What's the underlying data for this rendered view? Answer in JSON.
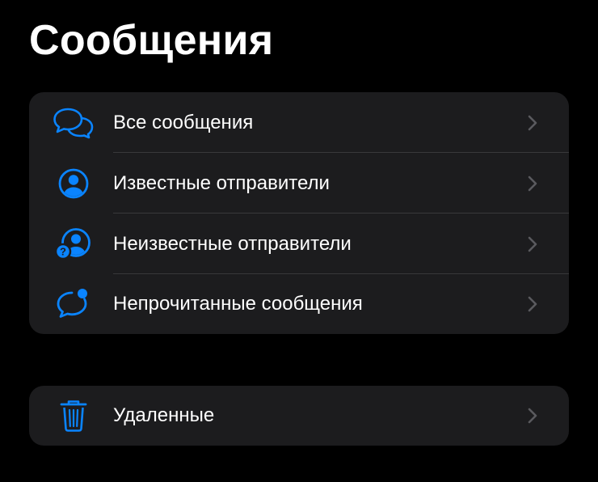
{
  "header": {
    "title": "Сообщения"
  },
  "filters": [
    {
      "id": "all",
      "label": "Все сообщения",
      "icon": "chat-bubbles-icon"
    },
    {
      "id": "known",
      "label": "Известные отправители",
      "icon": "person-circle-icon"
    },
    {
      "id": "unknown",
      "label": "Неизвестные отправители",
      "icon": "person-question-icon"
    },
    {
      "id": "unread",
      "label": "Непрочитанные сообщения",
      "icon": "unread-bubble-icon"
    }
  ],
  "trash": {
    "label": "Удаленные",
    "icon": "trash-icon"
  },
  "colors": {
    "accent": "#0a84ff",
    "background": "#000000",
    "group": "#1c1c1e",
    "separator": "#38383a",
    "chevron": "#5a5a5e"
  }
}
